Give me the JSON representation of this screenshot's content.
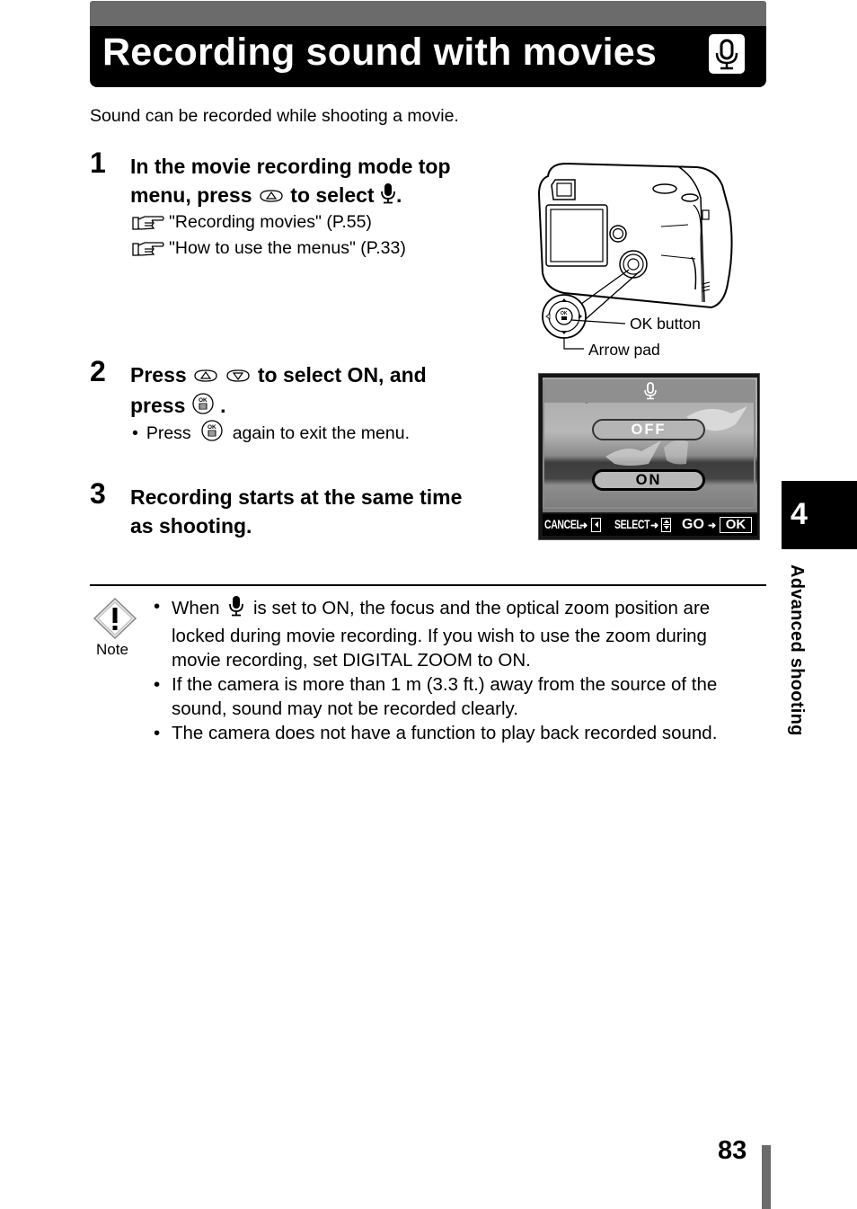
{
  "header": {
    "title": "Recording sound with movies",
    "icon": "microphone-icon"
  },
  "intro": "Sound can be recorded while shooting a movie.",
  "steps": [
    {
      "number": "1",
      "line1": "In the movie recording mode top",
      "line2_pre": "menu, press",
      "line2_mid": "to select",
      "line2_end": ".",
      "icons": [
        "arrow-up-button-icon",
        "microphone-icon"
      ],
      "references": [
        {
          "icon": "reference-hand-icon",
          "text": "\"Recording movies\" (P.55)"
        },
        {
          "icon": "reference-hand-icon",
          "text": "\"How to use the menus\" (P.33)"
        }
      ]
    },
    {
      "number": "2",
      "line1_pre": "Press",
      "line1_post": "to select ON, and",
      "line2_pre": "press",
      "line2_end": ".",
      "icons": [
        "arrow-up-button-icon",
        "arrow-down-button-icon",
        "ok-button-icon"
      ],
      "bullet": {
        "pre": "Press",
        "post": "again to exit the menu.",
        "icon": "ok-button-icon"
      }
    },
    {
      "number": "3",
      "line1": "Recording starts at the same time",
      "line2": "as shooting."
    }
  ],
  "camera_figure": {
    "callouts": {
      "ok_button": "OK button",
      "arrow_pad": "Arrow pad"
    }
  },
  "lcd_screen": {
    "header_icon": "microphone-icon",
    "options": [
      {
        "label": "OFF",
        "selected": false
      },
      {
        "label": "ON",
        "selected": true
      }
    ],
    "bottom_bar": {
      "cancel_label": "CANCEL",
      "select_label": "SELECT",
      "go_label": "GO",
      "ok_key": "OK"
    }
  },
  "note": {
    "label": "Note",
    "icon": "warning-diamond-icon",
    "items": [
      {
        "pre": "When",
        "icon": "microphone-icon",
        "line1_post": "is set to ON, the focus and the optical zoom position are",
        "line2": "locked during movie recording. If you wish to use the zoom during",
        "line3": "movie recording, set DIGITAL ZOOM to ON."
      },
      {
        "line1": "If the camera is more than 1 m (3.3 ft.) away from the source of the",
        "line2": "sound, sound may not be recorded clearly."
      },
      {
        "line1": "The camera does not have a function to play back recorded sound."
      }
    ]
  },
  "side_tab": {
    "chapter_number": "4",
    "chapter_label": "Advanced shooting"
  },
  "footer": {
    "page_number": "83"
  },
  "bullet_char": "•"
}
